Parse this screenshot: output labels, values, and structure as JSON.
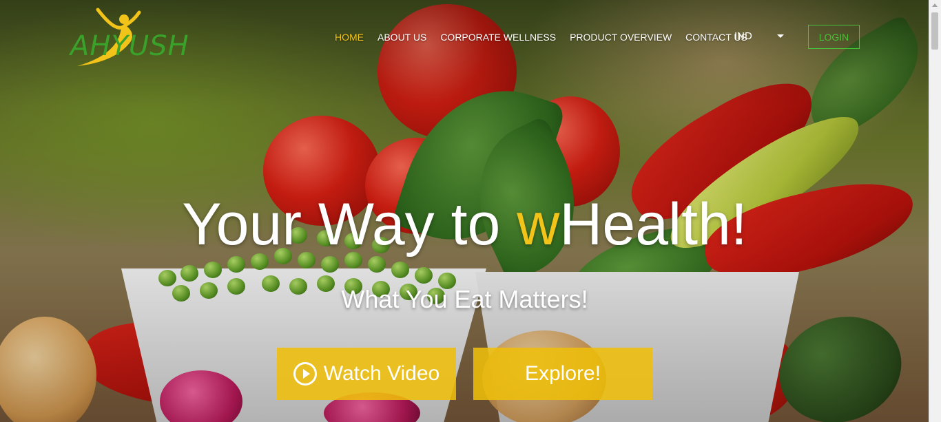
{
  "brand": {
    "logo_text": "AHYUSH"
  },
  "nav": {
    "items": [
      {
        "label": "HOME",
        "active": true
      },
      {
        "label": "ABOUT US",
        "active": false
      },
      {
        "label": "CORPORATE WELLNESS",
        "active": false
      },
      {
        "label": "PRODUCT OVERVIEW",
        "active": false
      },
      {
        "label": "CONTACT US",
        "active": false
      }
    ],
    "language": "IND",
    "login_label": "LOGIN"
  },
  "hero": {
    "title_before": "Your Way to ",
    "title_highlight": "w",
    "title_after": "Health!",
    "subtitle": "What You Eat Matters!",
    "watch_video_label": "Watch Video",
    "explore_label": "Explore!"
  },
  "colors": {
    "accent": "#f2c318",
    "brand_green": "#3aa12b",
    "login_border": "#48c23a",
    "button_bg": "#eebe0a"
  },
  "icons": {
    "play": "play-circle-icon",
    "dropdown": "caret-down-icon"
  }
}
